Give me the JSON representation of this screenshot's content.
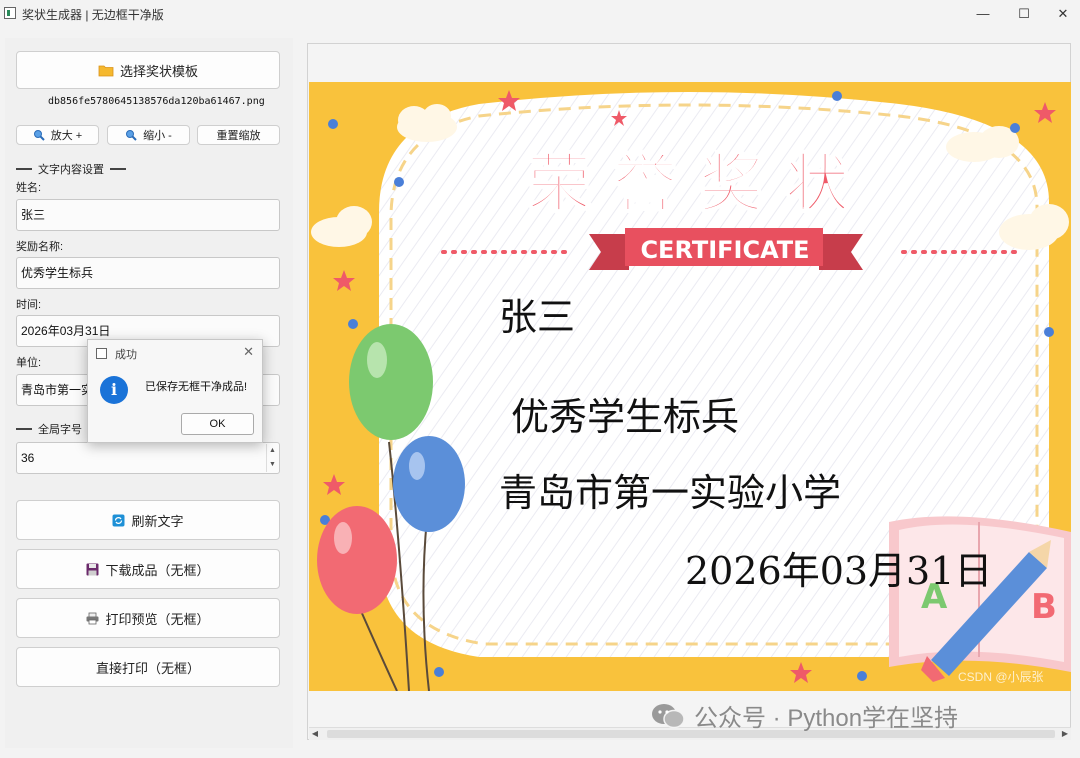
{
  "window": {
    "title": "奖状生成器 | 无边框干净版",
    "controls": {
      "minimize": "—",
      "maximize": "☐",
      "close": "✕"
    }
  },
  "sidebar": {
    "select_template_label": "选择奖状模板",
    "template_filename": "db856fe5780645138576da120ba61467.png",
    "zoom_in_label": "放大 +",
    "zoom_out_label": "缩小 -",
    "reset_zoom_label": "重置缩放",
    "text_section_title": "文字内容设置",
    "name_label": "姓名:",
    "name_value": "张三",
    "award_label": "奖励名称:",
    "award_value": "优秀学生标兵",
    "date_label": "时间:",
    "date_value": "2026年03月31日",
    "unit_label": "单位:",
    "unit_value": "青岛市第一实验小学",
    "font_section_title": "全局字号",
    "font_size_value": "36",
    "refresh_label": "刷新文字",
    "download_label": "下载成品（无框）",
    "print_preview_label": "打印预览（无框）",
    "print_label": "直接打印（无框）"
  },
  "certificate": {
    "title": "荣誉奖状",
    "subtitle": "CERTIFICATE",
    "name": "张三",
    "award": "优秀学生标兵",
    "unit": "青岛市第一实验小学",
    "date": "2026年03月31日",
    "corner_letters": [
      "A",
      "B"
    ]
  },
  "dialog": {
    "title": "成功",
    "message": "已保存无框干净成品!",
    "ok_label": "OK"
  },
  "overlay": {
    "wechat_watermark": "公众号 · Python学在坚持",
    "csdn_mark": "CSDN @小辰张"
  },
  "colors": {
    "frame_yellow": "#f9c23c",
    "title_red": "#ef5a68",
    "ribbon_red": "#e8505f",
    "info_blue": "#1a73d8"
  }
}
